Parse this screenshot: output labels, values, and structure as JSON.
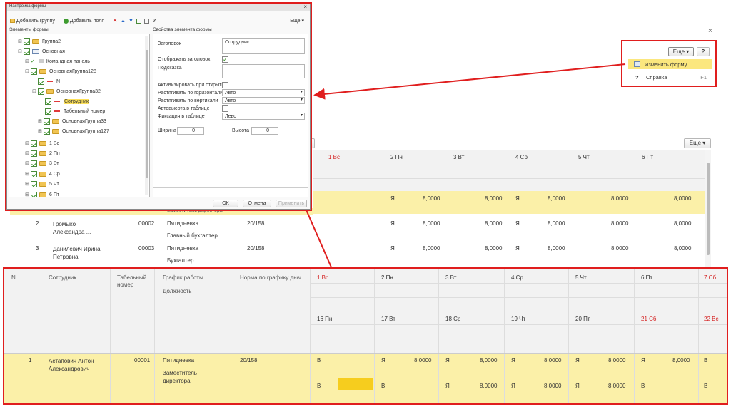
{
  "dialog": {
    "title": "Настройка формы",
    "close": "×",
    "toolbar": {
      "add_group": "Добавить группу",
      "add_fields": "Добавить поля",
      "help": "?",
      "more": "Еще"
    },
    "left_header": "Элементы формы",
    "right_header": "Свойства элемента формы",
    "tree": [
      {
        "label": "Группа2"
      },
      {
        "label": "Основная"
      },
      {
        "label": "Командная панель"
      },
      {
        "label": "ОсновнаяГруппа128"
      },
      {
        "label": "N"
      },
      {
        "label": "ОсновнаяГруппа32"
      },
      {
        "label": "Сотрудник"
      },
      {
        "label": "Табельный номер"
      },
      {
        "label": "ОсновнаяГруппа33"
      },
      {
        "label": "ОсновнаяГруппа127"
      },
      {
        "label": "1 Вс"
      },
      {
        "label": "2 Пн"
      },
      {
        "label": "3 Вт"
      },
      {
        "label": "4 Ср"
      },
      {
        "label": "5 Чт"
      },
      {
        "label": "6 Пт"
      }
    ],
    "props": {
      "title_label": "Заголовок",
      "title_value": "Сотрудник",
      "show_title_label": "Отображать заголовок",
      "hint_label": "Подсказка",
      "activate_label": "Активизировать при открытии",
      "stretch_h_label": "Растягивать по горизонтали",
      "stretch_h_value": "Авто",
      "stretch_v_label": "Растягивать по вертикали",
      "stretch_v_value": "Авто",
      "autoheight_label": "Автовысота в таблице",
      "fix_label": "Фиксация в таблице",
      "fix_value": "Лево",
      "width_label": "Ширина",
      "width_value": "0",
      "height_label": "Высота",
      "height_value": "0"
    },
    "buttons": {
      "ok": "ОК",
      "cancel": "Отмена",
      "apply": "Применить"
    }
  },
  "page": {
    "close": "×",
    "more": "Еще",
    "help": "?"
  },
  "menu": {
    "change_form": "Изменить форму...",
    "help": "Справка",
    "help_shortcut": "F1"
  },
  "top_table": {
    "days": [
      "1 Вс",
      "2 Пн",
      "3 Вт",
      "4 Ср",
      "5 Чт",
      "6 Пт"
    ],
    "more": "Еще",
    "row1": {
      "vals": [
        "Я",
        "8,0000",
        "8,0000",
        "Я",
        "8,0000",
        "8,0000"
      ],
      "pos": "Заместитель директора"
    },
    "row2": {
      "n": "2",
      "name": "Громыко Александра ...",
      "tab": "00002",
      "sched": "Пятидневка",
      "norm": "20/158",
      "pos": "Главный бухгалтер",
      "vals": [
        "Я",
        "8,0000",
        "8,0000",
        "Я",
        "8,0000",
        "8,0000"
      ]
    },
    "row3": {
      "n": "3",
      "name": "Данилевич Ирина Петровна",
      "tab": "00003",
      "sched": "Пятидневка",
      "norm": "20/158",
      "pos": "Бухгалтер",
      "vals": [
        "Я",
        "8,0000",
        "8,0000",
        "Я",
        "8,0000",
        "8,0000"
      ]
    }
  },
  "bottom_table": {
    "headers": {
      "n": "N",
      "employee": "Сотрудник",
      "tab": "Табельный номер",
      "schedule": "График работы",
      "position": "Должность",
      "norm": "Норма по графику дн/ч"
    },
    "days1": [
      "1 Вс",
      "2 Пн",
      "3 Вт",
      "4 Ср",
      "5 Чт",
      "6 Пт",
      "7 Сб"
    ],
    "days2": [
      "16 Пн",
      "17 Вт",
      "18 Ср",
      "19 Чт",
      "20 Пт",
      "21 Сб",
      "22 Вс"
    ],
    "row": {
      "n": "1",
      "name": "Астапович Антон Александрович",
      "tab": "00001",
      "sched": "Пятидневка",
      "pos": "Заместитель директора",
      "norm": "20/158",
      "line1": [
        "В",
        "Я",
        "8,0000",
        "Я",
        "8,0000",
        "Я",
        "8,0000",
        "Я",
        "8,0000",
        "Я",
        "8,0000",
        "В"
      ],
      "line2": [
        "В",
        "В",
        "Я",
        "8,0000",
        "Я",
        "8,0000",
        "Я",
        "8,0000",
        "В",
        "В"
      ]
    }
  },
  "colors": {
    "accent_red": "#e01e1e",
    "highlight": "#fbf0a8"
  }
}
